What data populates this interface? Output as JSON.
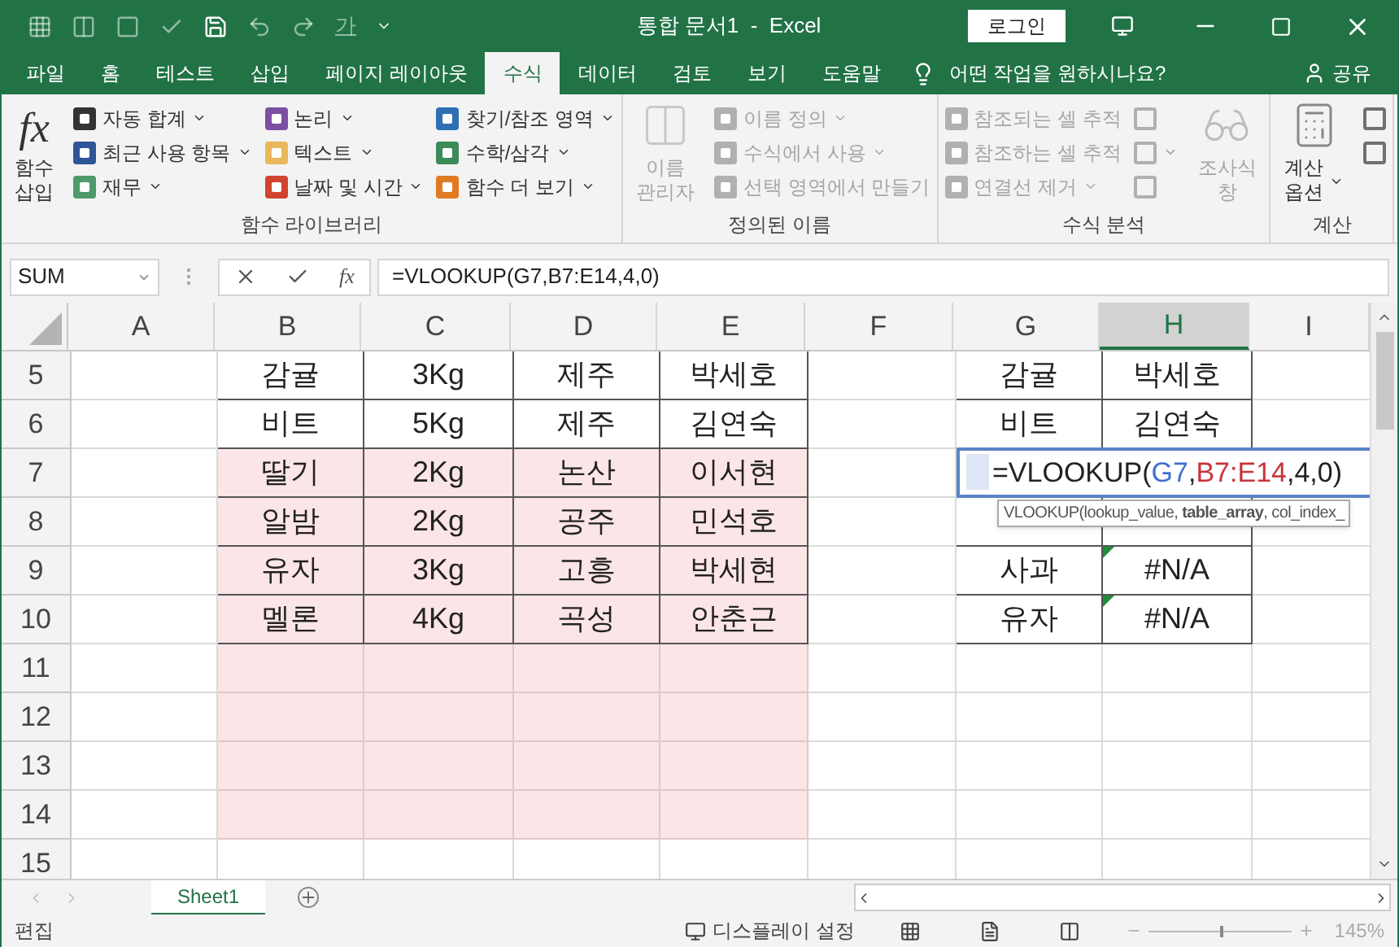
{
  "window": {
    "title": "통합 문서1  -  Excel",
    "quick_access_text": "가",
    "login_button": "로그인"
  },
  "tabs": [
    {
      "label": "파일",
      "selected": false
    },
    {
      "label": "홈",
      "selected": false
    },
    {
      "label": "테스트",
      "selected": false
    },
    {
      "label": "삽입",
      "selected": false
    },
    {
      "label": "페이지 레이아웃",
      "selected": false
    },
    {
      "label": "수식",
      "selected": true
    },
    {
      "label": "데이터",
      "selected": false
    },
    {
      "label": "검토",
      "selected": false
    },
    {
      "label": "보기",
      "selected": false
    },
    {
      "label": "도움말",
      "selected": false
    }
  ],
  "tell_me": "어떤 작업을 원하시나요?",
  "share": "공유",
  "ribbon": [
    {
      "label": "함수 라이브러리",
      "disabled": false,
      "large_first": {
        "kind": "function",
        "text_icon": "fx",
        "label": "함수\n삽입"
      },
      "columns": [
        [
          {
            "label": "자동 합계",
            "dropdown": true,
            "color": "#333333"
          },
          {
            "label": "최근 사용 항목",
            "dropdown": true,
            "color": "#2f5597"
          },
          {
            "label": "재무",
            "dropdown": true,
            "color": "#4e9a6a"
          }
        ],
        [
          {
            "label": "논리",
            "dropdown": true,
            "color": "#7b4fa3"
          },
          {
            "label": "텍스트",
            "dropdown": true,
            "color": "#e8b85a"
          },
          {
            "label": "날짜 및 시간",
            "dropdown": true,
            "color": "#d0442f"
          }
        ],
        [
          {
            "label": "찾기/참조 영역",
            "dropdown": true,
            "color": "#2f6fb5"
          },
          {
            "label": "수학/삼각",
            "dropdown": true,
            "color": "#3c8a5a"
          },
          {
            "label": "함수 더 보기",
            "dropdown": true,
            "color": "#e07b22"
          }
        ]
      ]
    },
    {
      "label": "정의된 이름",
      "disabled": true,
      "large_first": {
        "kind": "names",
        "label": "이름\n관리자"
      },
      "columns": [
        [
          {
            "label": "이름 정의",
            "dropdown": true,
            "color": "#b0b0b0"
          },
          {
            "label": "수식에서 사용",
            "dropdown": true,
            "color": "#b0b0b0"
          },
          {
            "label": "선택 영역에서 만들기",
            "dropdown": false,
            "color": "#b0b0b0"
          }
        ]
      ]
    },
    {
      "label": "수식 분석",
      "disabled": true,
      "columns": [
        [
          {
            "label": "참조되는 셀 추적",
            "dropdown": false,
            "color": "#b0b0b0"
          },
          {
            "label": "참조하는 셀 추적",
            "dropdown": false,
            "color": "#b0b0b0"
          },
          {
            "label": "연결선 제거",
            "dropdown": true,
            "color": "#b0b0b0"
          }
        ],
        [
          {
            "dropdown": false,
            "color": "#b0b0b0"
          },
          {
            "dropdown": true,
            "color": "#b0b0b0"
          },
          {
            "dropdown": false,
            "color": "#b0b0b0"
          }
        ]
      ],
      "large_last": {
        "kind": "watch",
        "label": "조사식\n창"
      }
    },
    {
      "label": "계산",
      "disabled": false,
      "large_first": {
        "kind": "calc",
        "label": "계산\n옵션",
        "dropdown": true
      },
      "columns": [
        [
          {
            "dropdown": false,
            "color": "#707070"
          },
          {
            "dropdown": false,
            "color": "#707070"
          }
        ]
      ]
    }
  ],
  "formula_bar": {
    "name_box": "SUM",
    "fx": "fx",
    "formula": "=VLOOKUP(G7,B7:E14,4,0)"
  },
  "columns": [
    {
      "label": "A",
      "selected": false,
      "in_reference": false,
      "table": false
    },
    {
      "label": "B",
      "selected": false,
      "in_reference": true,
      "table": true
    },
    {
      "label": "C",
      "selected": false,
      "in_reference": true,
      "table": true
    },
    {
      "label": "D",
      "selected": false,
      "in_reference": true,
      "table": true
    },
    {
      "label": "E",
      "selected": false,
      "in_reference": true,
      "table": true
    },
    {
      "label": "F",
      "selected": false,
      "in_reference": false,
      "table": false
    },
    {
      "label": "G",
      "selected": false,
      "in_reference": false,
      "table": true
    },
    {
      "label": "H",
      "selected": true,
      "in_reference": false,
      "table": true
    },
    {
      "label": "I",
      "selected": false,
      "in_reference": false,
      "table": false
    }
  ],
  "rows": [
    {
      "header": "5",
      "highlighted": false,
      "table_border": true,
      "cells": [
        "",
        "감귤",
        "3Kg",
        "제주",
        "박세호",
        "",
        "감귤",
        "박세호",
        ""
      ]
    },
    {
      "header": "6",
      "highlighted": false,
      "table_border": true,
      "cells": [
        "",
        "비트",
        "5Kg",
        "제주",
        "김연숙",
        "",
        "비트",
        "김연숙",
        ""
      ]
    },
    {
      "header": "7",
      "highlighted": true,
      "table_border": true,
      "cells": [
        "",
        "딸기",
        "2Kg",
        "논산",
        "이서현",
        "",
        {
          "kind": "editing",
          "segments": [
            {
              "text": "=VLOOKUP("
            },
            {
              "text": "G7",
              "color": "#3f6fd0"
            },
            {
              "text": ","
            },
            {
              "text": "B7:E14",
              "color": "#c8333a"
            },
            {
              "text": ",4,0)"
            }
          ],
          "tooltip": "VLOOKUP(lookup_value, **table_array**, col_index_"
        },
        "",
        ""
      ]
    },
    {
      "header": "8",
      "highlighted": true,
      "table_border": true,
      "cells": [
        "",
        "알밤",
        "2Kg",
        "공주",
        "민석호",
        "",
        "",
        "",
        ""
      ]
    },
    {
      "header": "9",
      "highlighted": true,
      "table_border": true,
      "cells": [
        "",
        "유자",
        "3Kg",
        "고흥",
        "박세현",
        "",
        "사과",
        {
          "kind": "text",
          "text": "#N/A",
          "error_mark": true
        },
        ""
      ]
    },
    {
      "header": "10",
      "highlighted": true,
      "table_border": true,
      "cells": [
        "",
        "멜론",
        "4Kg",
        "곡성",
        "안춘근",
        "",
        "유자",
        {
          "kind": "text",
          "text": "#N/A",
          "error_mark": true
        },
        ""
      ]
    },
    {
      "header": "11",
      "highlighted": true,
      "table_border": false,
      "cells": []
    },
    {
      "header": "12",
      "highlighted": true,
      "table_border": false,
      "cells": []
    },
    {
      "header": "13",
      "highlighted": true,
      "table_border": false,
      "cells": []
    },
    {
      "header": "14",
      "highlighted": true,
      "table_border": false,
      "cells": []
    },
    {
      "header": "15",
      "highlighted": false,
      "table_border": false,
      "cells": []
    }
  ],
  "sheet_tabs": [
    {
      "label": "Sheet1",
      "selected": true
    }
  ],
  "status_bar": {
    "mode": "편집",
    "display_settings": "디스플레이 설정",
    "zoom_slider": {
      "level": 0.5
    },
    "zoom": "145%"
  }
}
